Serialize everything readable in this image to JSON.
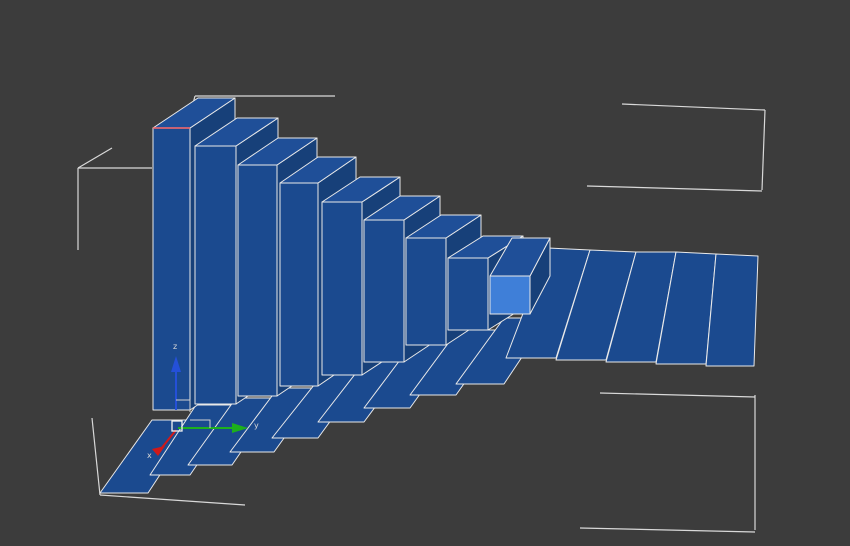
{
  "viewport": {
    "background": "#3c3c3c",
    "bracket_color": "#d9d9d9",
    "object_fill_top": "#1f4f98",
    "object_fill_front": "#1b4a8f",
    "object_fill_side": "#174079",
    "object_edge_color": "#e9e9e9",
    "selected_fill": "#3f7fd8",
    "selected_edge": "#ff6a6a"
  },
  "gizmo": {
    "axis_x_label": "x",
    "axis_y_label": "y",
    "axis_z_label": "z",
    "axis_x_color": "#d01919",
    "axis_y_color": "#1db01d",
    "axis_z_color": "#2450d8",
    "pivot_icon": "pivot-square-icon"
  }
}
